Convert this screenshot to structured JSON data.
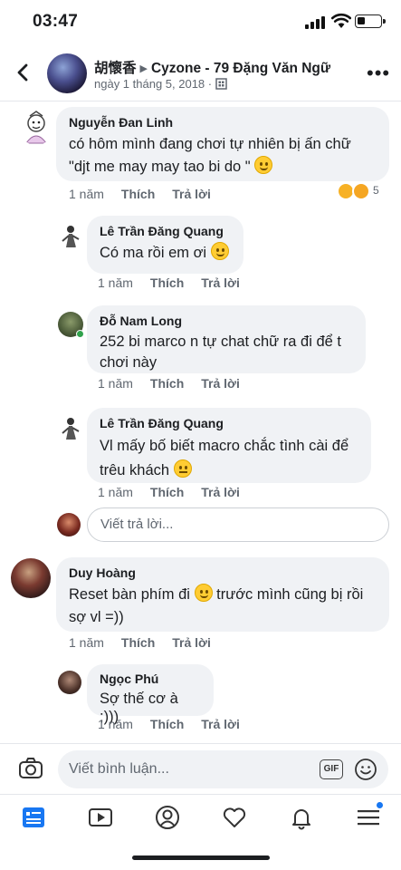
{
  "status_bar": {
    "time": "03:47",
    "battery_level": 0.35
  },
  "header": {
    "author": "胡懷香",
    "page": "Cyzone - 79 Đặng Văn Ngữ",
    "date": "ngày 1 tháng 5, 2018",
    "separator": "·"
  },
  "comments": [
    {
      "name": "Nguyễn Đan Linh",
      "text": "có hôm mình đang chơi  tự nhiên  bị ấn chữ\n\"djt me may may tao bi do \"",
      "emoji": "smile",
      "time": "1 năm",
      "like": "Thích",
      "reply": "Trả lời",
      "reaction_count": "5"
    },
    {
      "name": "Lê Trần Đăng Quang",
      "text": "Có ma rồi em ơi",
      "emoji": "grin",
      "time": "1 năm",
      "like": "Thích",
      "reply": "Trả lời"
    },
    {
      "name": "Đỗ Nam Long",
      "text": "252 bi marco n tự chat chữ ra đi để t\nchơi này",
      "time": "1 năm",
      "like": "Thích",
      "reply": "Trả lời"
    },
    {
      "name": "Lê Trần Đăng Quang",
      "text": "Vl mấy bố biết macro chắc tình cài để\ntrêu khách",
      "emoji": "grimace",
      "time": "1 năm",
      "like": "Thích",
      "reply": "Trả lời"
    },
    {
      "name": "Duy Hoàng",
      "text_a": "Reset bàn phím đi",
      "text_b": "trước mình cũng bị rồi\nsợ vl =))",
      "emoji": "smile",
      "time": "1 năm",
      "like": "Thích",
      "reply": "Trả lời"
    },
    {
      "name": "Ngọc Phú",
      "text": "Sợ thế cơ à ;)))",
      "time": "1 năm",
      "like": "Thích",
      "reply": "Trả lời"
    }
  ],
  "reply_box": {
    "placeholder": "Viết trả lời..."
  },
  "composer": {
    "placeholder": "Viết bình luận...",
    "gif_label": "GIF"
  },
  "tabs": [
    "news-feed",
    "watch",
    "profile",
    "dating",
    "notifications",
    "menu"
  ],
  "colors": {
    "accent": "#1877f2",
    "bubble": "#f0f2f5"
  }
}
